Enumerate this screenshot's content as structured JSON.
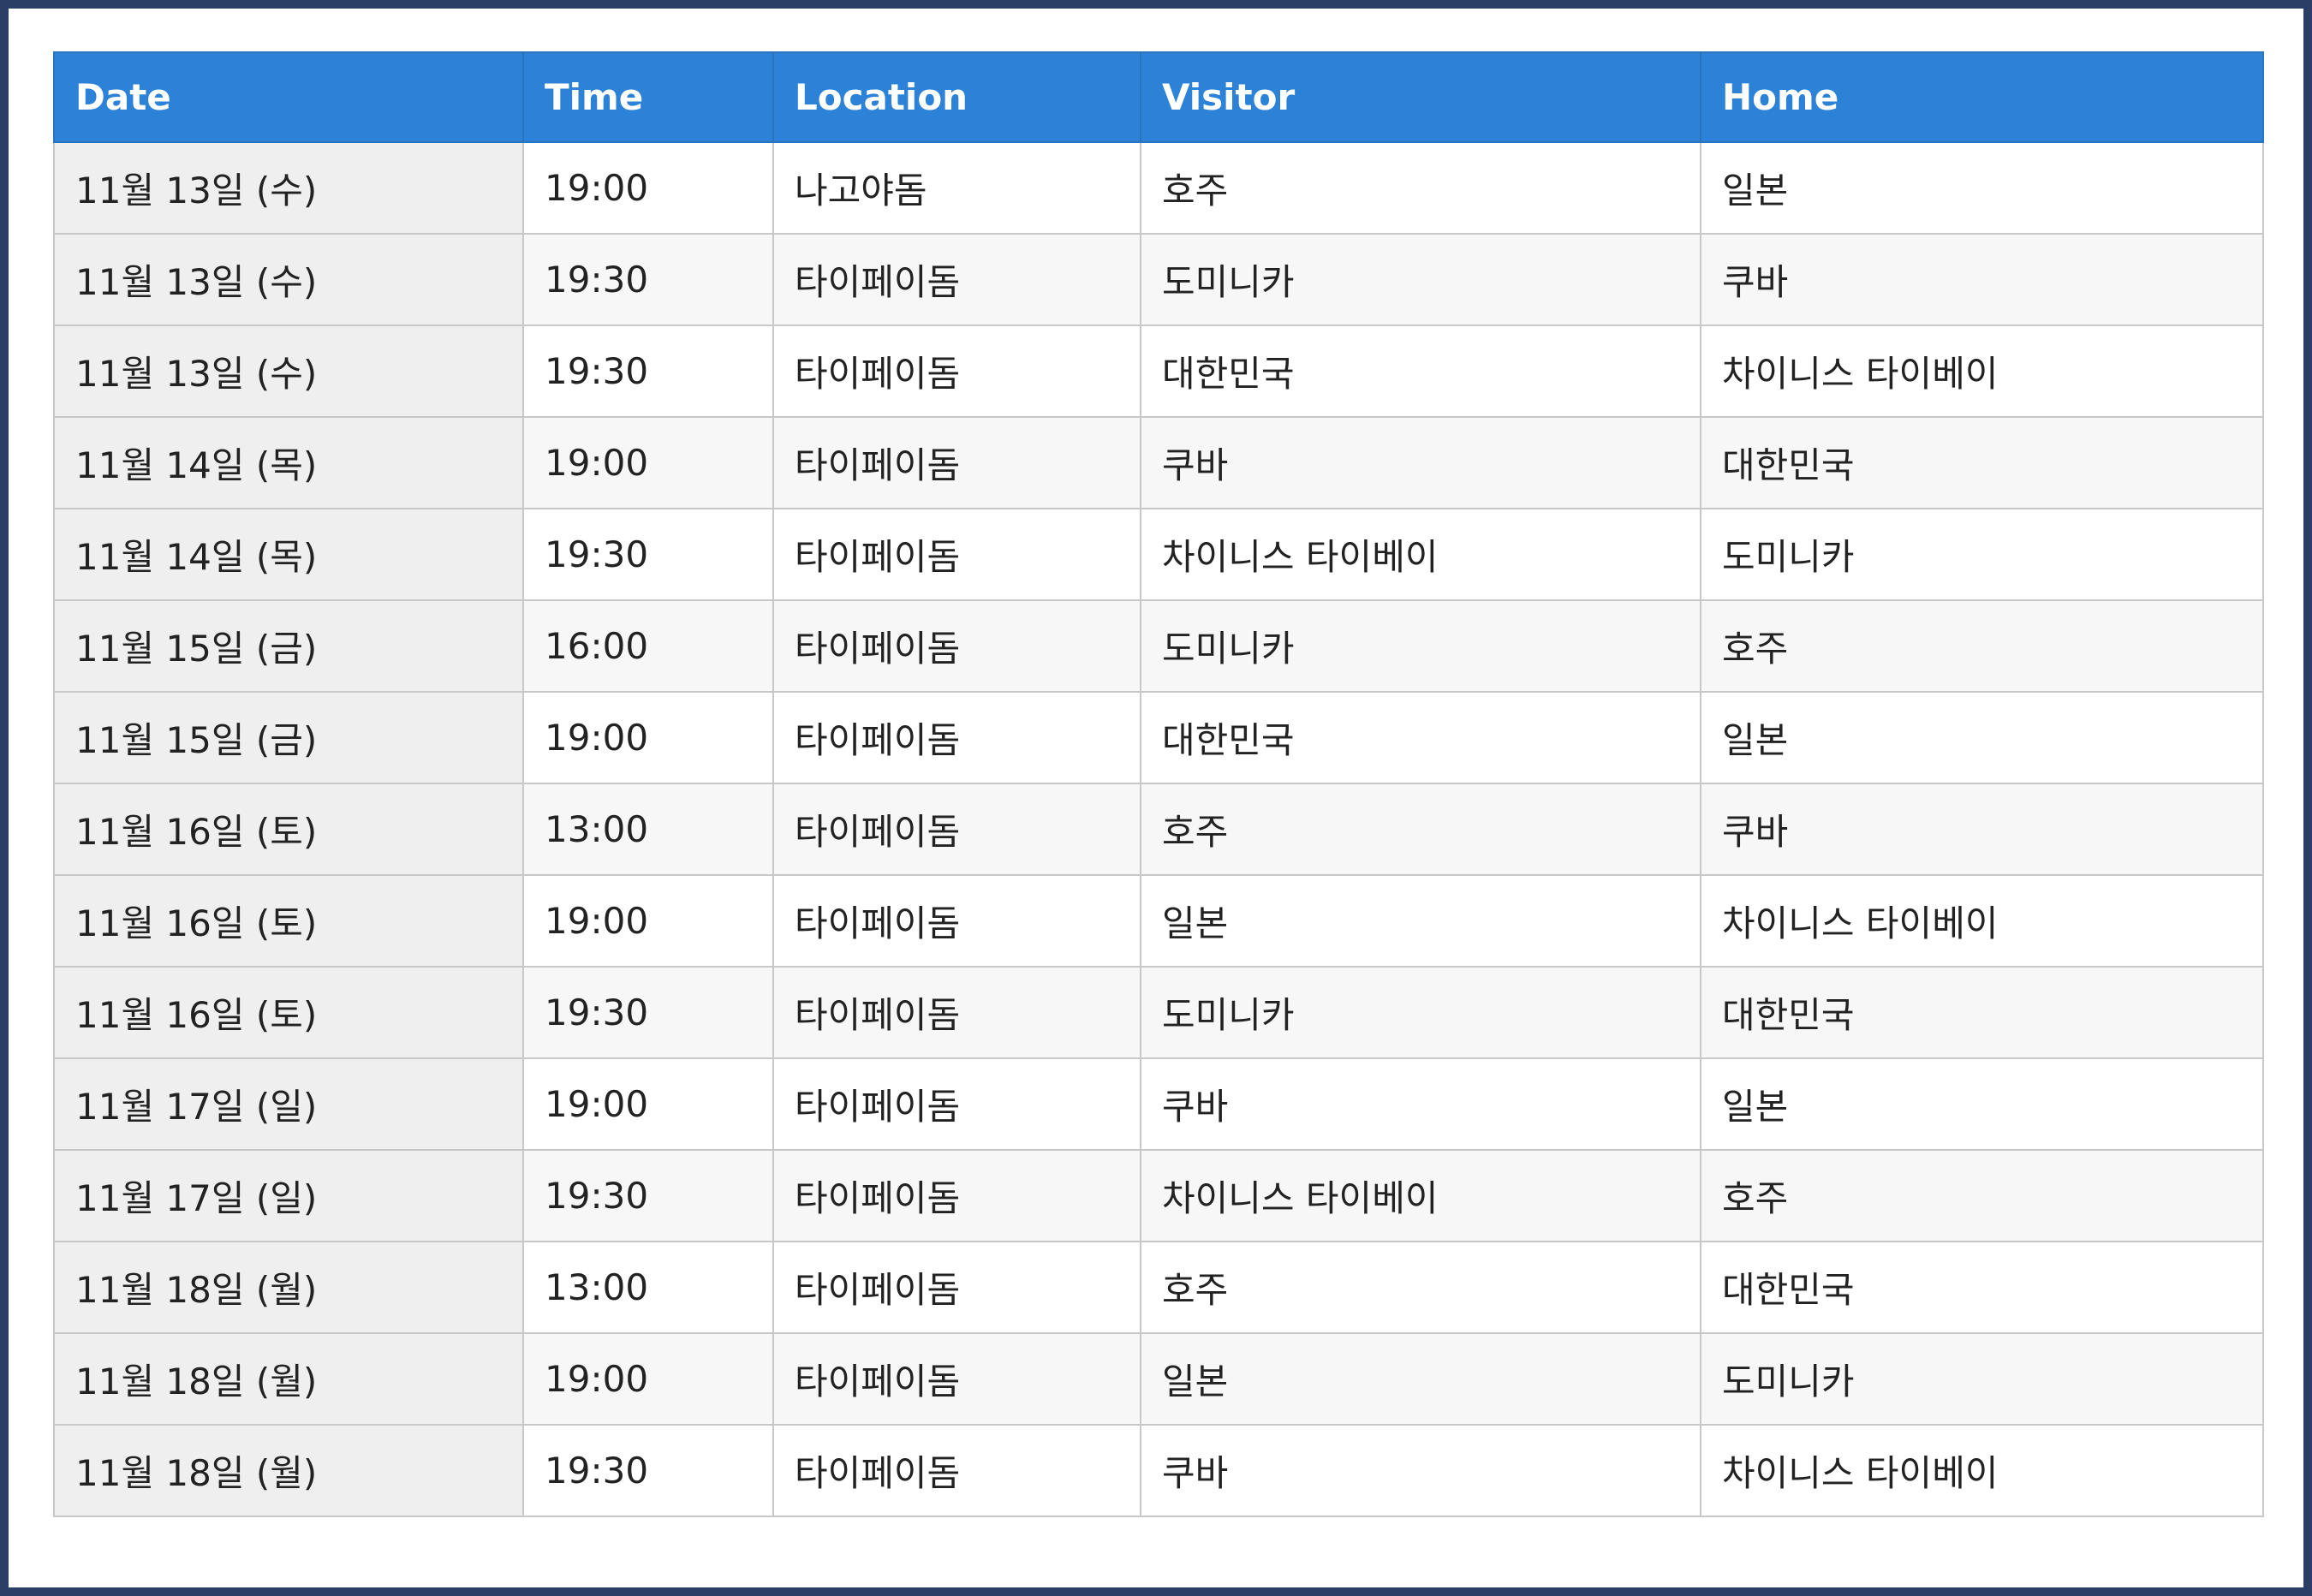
{
  "table": {
    "headers": [
      "Date",
      "Time",
      "Location",
      "Visitor",
      "Home"
    ],
    "rows": [
      [
        "11월 13일 (수)",
        "19:00",
        "나고야돔",
        "호주",
        "일본"
      ],
      [
        "11월 13일 (수)",
        "19:30",
        "타이페이돔",
        "도미니카",
        "쿠바"
      ],
      [
        "11월 13일 (수)",
        "19:30",
        "타이페이돔",
        "대한민국",
        "차이니스 타이베이"
      ],
      [
        "11월 14일 (목)",
        "19:00",
        "타이페이돔",
        "쿠바",
        "대한민국"
      ],
      [
        "11월 14일 (목)",
        "19:30",
        "타이페이돔",
        "차이니스 타이베이",
        "도미니카"
      ],
      [
        "11월 15일 (금)",
        "16:00",
        "타이페이돔",
        "도미니카",
        "호주"
      ],
      [
        "11월 15일 (금)",
        "19:00",
        "타이페이돔",
        "대한민국",
        "일본"
      ],
      [
        "11월 16일 (토)",
        "13:00",
        "타이페이돔",
        "호주",
        "쿠바"
      ],
      [
        "11월 16일 (토)",
        "19:00",
        "타이페이돔",
        "일본",
        "차이니스 타이베이"
      ],
      [
        "11월 16일 (토)",
        "19:30",
        "타이페이돔",
        "도미니카",
        "대한민국"
      ],
      [
        "11월 17일 (일)",
        "19:00",
        "타이페이돔",
        "쿠바",
        "일본"
      ],
      [
        "11월 17일 (일)",
        "19:30",
        "타이페이돔",
        "차이니스 타이베이",
        "호주"
      ],
      [
        "11월 18일 (월)",
        "13:00",
        "타이페이돔",
        "호주",
        "대한민국"
      ],
      [
        "11월 18일 (월)",
        "19:00",
        "타이페이돔",
        "일본",
        "도미니카"
      ],
      [
        "11월 18일 (월)",
        "19:30",
        "타이페이돔",
        "쿠바",
        "차이니스 타이베이"
      ]
    ]
  },
  "colors": {
    "header_background": "#2b82d6",
    "header_text": "#ffffff",
    "border": "#c8c8c8",
    "outer_frame": "#2b3f66"
  }
}
